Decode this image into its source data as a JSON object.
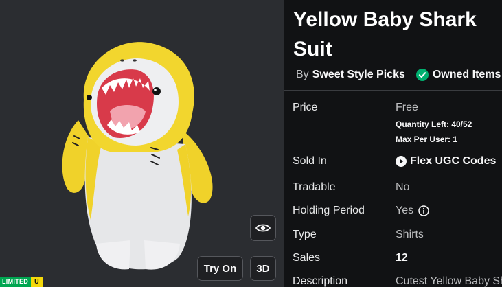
{
  "item": {
    "title": "Yellow Baby Shark Suit",
    "by_label": "By",
    "creator": "Sweet Style Picks",
    "owned_label": "Owned Items (("
  },
  "viewer": {
    "try_on_label": "Try On",
    "three_d_label": "3D",
    "eye_icon": "eye-icon"
  },
  "badge": {
    "limited": "LIMITED",
    "u": "U"
  },
  "details": {
    "price_label": "Price",
    "price_value": "Free",
    "quantity_left": "Quantity Left: 40/52",
    "max_per_user": "Max Per User: 1",
    "sold_in_label": "Sold In",
    "sold_in_value": "Flex UGC Codes",
    "tradable_label": "Tradable",
    "tradable_value": "No",
    "holding_label": "Holding Period",
    "holding_value": "Yes",
    "type_label": "Type",
    "type_value": "Shirts",
    "sales_label": "Sales",
    "sales_value": "12",
    "description_label": "Description",
    "description_value": "Cutest Yellow Baby Sh"
  },
  "colors": {
    "preview_bg": "#2b2d31",
    "panel_bg": "#111214",
    "owned_check": "#00b06f",
    "limited_green": "#00a651",
    "u_yellow": "#f5d90a",
    "shark_yellow": "#f2d62e",
    "shark_white": "#e9eaec"
  }
}
